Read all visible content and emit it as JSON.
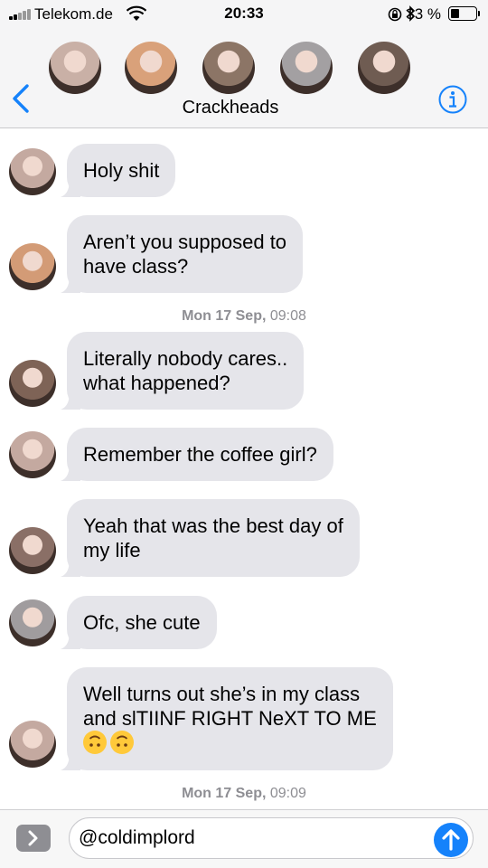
{
  "status_bar": {
    "carrier": "Telekom.de",
    "time": "20:33",
    "battery_percent_label": "33 %",
    "battery_level": 0.33
  },
  "header": {
    "group_name": "Crackheads",
    "avatar_colors": [
      "#c9b0a6",
      "#d9a17a",
      "#8c7566",
      "#a3a0a2",
      "#6f5c52"
    ]
  },
  "messages": [
    {
      "text_lines": [
        "Holy shit"
      ],
      "avatar_color": "#c4a9a0"
    },
    {
      "text_lines": [
        "Aren’t you supposed to",
        "have class?"
      ],
      "avatar_color": "#d39b76"
    },
    {
      "timestamp_day": "Mon 17 Sep,",
      "timestamp_time": "09:08"
    },
    {
      "text_lines": [
        "Literally nobody cares..",
        "what happened?"
      ],
      "avatar_color": "#7e6356"
    },
    {
      "text_lines": [
        "Remember the coffee girl?"
      ],
      "avatar_color": "#c4a9a0"
    },
    {
      "text_lines": [
        "Yeah that was the best day of",
        "my life"
      ],
      "avatar_color": "#8a6f66"
    },
    {
      "text_lines": [
        "Ofc, she cute"
      ],
      "avatar_color": "#a09c9e"
    },
    {
      "text_lines": [
        "Well turns out she’s in my class",
        "and slTIINF RIGHT NeXT TO ME"
      ],
      "emojis": [
        "upside-down-face",
        "upside-down-face"
      ],
      "avatar_color": "#c4a9a0"
    },
    {
      "timestamp_day": "Mon 17 Sep,",
      "timestamp_time": "09:09"
    }
  ],
  "compose": {
    "input_value": "@coldimplord"
  },
  "colors": {
    "bubble_gray": "#e5e5ea",
    "ios_blue": "#1582fb",
    "timestamp_gray": "#8e8e93"
  }
}
